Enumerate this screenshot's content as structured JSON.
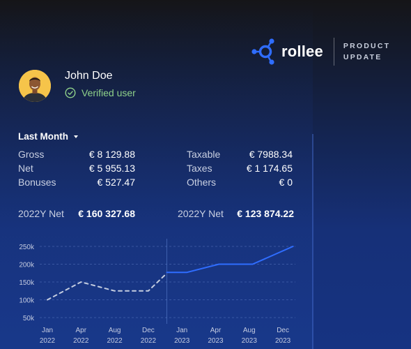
{
  "brand": {
    "name": "rollee",
    "tagline_line1": "PRODUCT",
    "tagline_line2": "UPDATE",
    "accent": "#2f6dff"
  },
  "user": {
    "name": "John Doe",
    "status": "Verified user",
    "status_color": "#8fd18a"
  },
  "period": {
    "selected": "Last Month"
  },
  "summary": {
    "left": [
      {
        "label": "Gross",
        "value": "€ 8 129.88"
      },
      {
        "label": "Net",
        "value": "€ 5 955.13"
      },
      {
        "label": "Bonuses",
        "value": "€ 527.47"
      }
    ],
    "right": [
      {
        "label": "Taxable",
        "value": "€ 7988.34"
      },
      {
        "label": "Taxes",
        "value": "€ 1 174.65"
      },
      {
        "label": "Others",
        "value": "€ 0"
      }
    ]
  },
  "yearly": [
    {
      "label": "2022Y Net",
      "value": "€ 160 327.68"
    },
    {
      "label": "2022Y Net",
      "value": "€ 123 874.22"
    }
  ],
  "chart_data": {
    "type": "line",
    "categories": [
      "Jan 2022",
      "Apr 2022",
      "Aug 2022",
      "Dec 2022",
      "Jan 2023",
      "Apr 2023",
      "Aug 2023",
      "Dec 2023"
    ],
    "x_tick_labels": [
      [
        "Jan",
        "2022"
      ],
      [
        "Apr",
        "2022"
      ],
      [
        "Aug",
        "2022"
      ],
      [
        "Dec",
        "2022"
      ],
      [
        "Jan",
        "2023"
      ],
      [
        "Apr",
        "2023"
      ],
      [
        "Aug",
        "2023"
      ],
      [
        "Dec",
        "2023"
      ]
    ],
    "y_tick_labels": [
      "250k",
      "200k",
      "150k",
      "100k",
      "50k"
    ],
    "y_ticks": [
      250000,
      200000,
      150000,
      100000,
      50000
    ],
    "ylim": [
      50000,
      250000
    ],
    "grid": true,
    "series": [
      {
        "style": "dashed",
        "color": "#c4cde0",
        "points": [
          {
            "x": 0,
            "y": 100000
          },
          {
            "x": 1,
            "y": 150000
          },
          {
            "x": 2,
            "y": 125000
          },
          {
            "x": 3,
            "y": 125000
          },
          {
            "x": 3.5,
            "y": 170000
          }
        ]
      },
      {
        "style": "solid",
        "color": "#2f6dff",
        "points": [
          {
            "x": 3.55,
            "y": 177000
          },
          {
            "x": 4.15,
            "y": 177000
          },
          {
            "x": 5.1,
            "y": 200000
          },
          {
            "x": 6.1,
            "y": 200000
          },
          {
            "x": 7.3,
            "y": 250000
          }
        ]
      }
    ],
    "divider_x": 3.55
  }
}
